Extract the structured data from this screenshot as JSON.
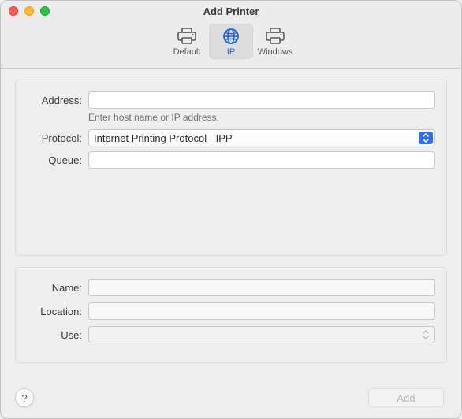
{
  "window": {
    "title": "Add Printer"
  },
  "toolbar": {
    "tabs": [
      {
        "id": "default",
        "label": "Default",
        "icon": "printer-icon",
        "selected": false
      },
      {
        "id": "ip",
        "label": "IP",
        "icon": "globe-icon",
        "selected": true
      },
      {
        "id": "windows",
        "label": "Windows",
        "icon": "printer-icon",
        "selected": false
      }
    ]
  },
  "form_top": {
    "address_label": "Address:",
    "address_value": "",
    "address_hint": "Enter host name or IP address.",
    "protocol_label": "Protocol:",
    "protocol_value": "Internet Printing Protocol - IPP",
    "queue_label": "Queue:",
    "queue_value": ""
  },
  "form_bottom": {
    "name_label": "Name:",
    "name_value": "",
    "location_label": "Location:",
    "location_value": "",
    "use_label": "Use:",
    "use_value": ""
  },
  "footer": {
    "help_label": "?",
    "add_label": "Add",
    "add_enabled": false
  }
}
